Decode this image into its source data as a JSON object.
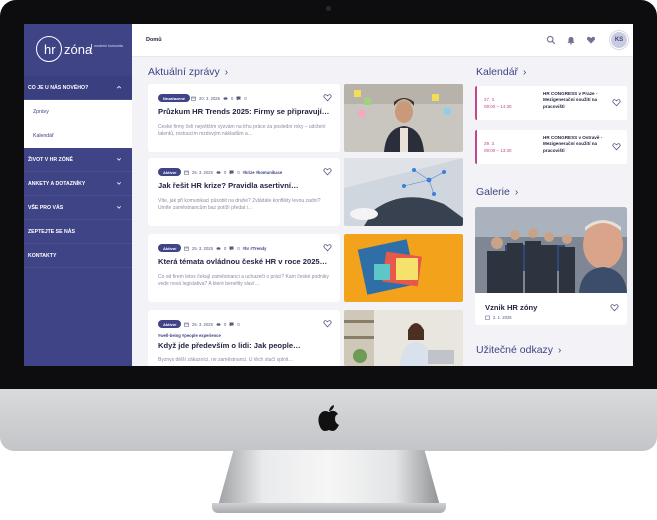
{
  "sidebar": {
    "logo": {
      "hr": "hr",
      "zona": "zóna",
      "tagline": "moderní komunita"
    },
    "items": [
      {
        "label": "CO JE U NÁS NOVÉHO?"
      },
      {
        "label": "Zprávy"
      },
      {
        "label": "Kalendář"
      },
      {
        "label": "ŽIVOT V HR ZÓNĚ"
      },
      {
        "label": "ANKETY A DOTAZNÍKY"
      },
      {
        "label": "VŠE PRO VÁS"
      },
      {
        "label": "ZEPTEJTE SE NÁS"
      },
      {
        "label": "KONTAKTY"
      }
    ]
  },
  "topbar": {
    "breadcrumb": "Domů",
    "avatar_initials": "KS"
  },
  "news": {
    "section_title": "Aktuální zprávy",
    "articles": [
      {
        "badge": "Nezařazené",
        "date": "20. 3. 2025",
        "views": "0",
        "comments": "0",
        "tags": "",
        "title": "Průzkum HR Trends 2025: Firmy se připravují…",
        "excerpt": "České firmy čelí největším výzvám na trhu práce za poslední roky – udržení talentů, rostoucím mzdovým nákladům a…"
      },
      {
        "badge": "Aktivní",
        "date": "25. 3. 2025",
        "views": "0",
        "comments": "0",
        "tags": "#krize  #komunikace",
        "title": "Jak řešit HR krize? Pravidla asertivní…",
        "excerpt": "Víte, jak při komunikaci působit na druhé? Zvládáte konflikty levou zadní? Umíte zaměstnancům baz potíží předat i…"
      },
      {
        "badge": "Aktivní",
        "date": "25. 3. 2025",
        "views": "0",
        "comments": "0",
        "tags": "#hr  #Trendy",
        "title": "Která témata ovládnou české HR v roce 2025…",
        "excerpt": "Co od firem letos čekají zaměstnanci a uchazeči o práci? Kam české podniky vede nová legislativa? A které benefity slaví…"
      },
      {
        "badge": "Aktivní",
        "date": "25. 3. 2025",
        "views": "0",
        "comments": "0",
        "tags": "#well-being  #people experience",
        "title": "Když jde především o lidi: Jak people…",
        "excerpt": "Byznys délší zákazníci, ne zaměstnanci. U těch stačí splnit…"
      }
    ]
  },
  "calendar": {
    "section_title": "Kalendář",
    "events": [
      {
        "date": "27. 3.",
        "time": "09:00 – 14:30",
        "title": "HR CONGRESS v Praze - Mezigenerační soužití na pracovišti"
      },
      {
        "date": "29. 3.",
        "time": "09:00 – 13:30",
        "title": "HR CONGRESS v Ostravě - Mezigenerační soužití na pracovišti"
      }
    ]
  },
  "gallery": {
    "section_title": "Galerie",
    "item_title": "Vznik HR zóny",
    "item_date": "2. 1. 2025"
  },
  "useful_links": {
    "section_title": "Užitečné odkazy"
  },
  "colors": {
    "primary": "#3f4486",
    "accent": "#c0488f",
    "background": "#f3f3f7"
  }
}
